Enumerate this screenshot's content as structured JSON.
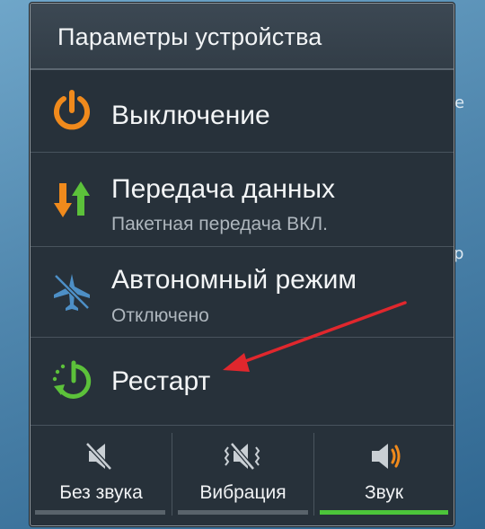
{
  "dialog": {
    "title": "Параметры устройства",
    "items": [
      {
        "title": "Выключение",
        "subtitle": "",
        "icon": "power-icon"
      },
      {
        "title": "Передача данных",
        "subtitle": "Пакетная передача ВКЛ.",
        "icon": "data-transfer-icon"
      },
      {
        "title": "Автономный режим",
        "subtitle": "Отключено",
        "icon": "airplane-icon"
      },
      {
        "title": "Рестарт",
        "subtitle": "",
        "icon": "restart-icon"
      }
    ],
    "sound_modes": [
      {
        "label": "Без звука",
        "icon": "mute-icon",
        "active": false
      },
      {
        "label": "Вибрация",
        "icon": "vibrate-icon",
        "active": false
      },
      {
        "label": "Звук",
        "icon": "sound-icon",
        "active": true
      }
    ]
  },
  "colors": {
    "power_icon": "#f08a1c",
    "data_down": "#f08a1c",
    "data_up": "#5cc13a",
    "airplane": "#4d8fc6",
    "restart": "#5cc13a",
    "sound_active_icon": "#f08a1c",
    "active_indicator": "#4cc43a",
    "annotation_arrow": "#e0272d"
  }
}
